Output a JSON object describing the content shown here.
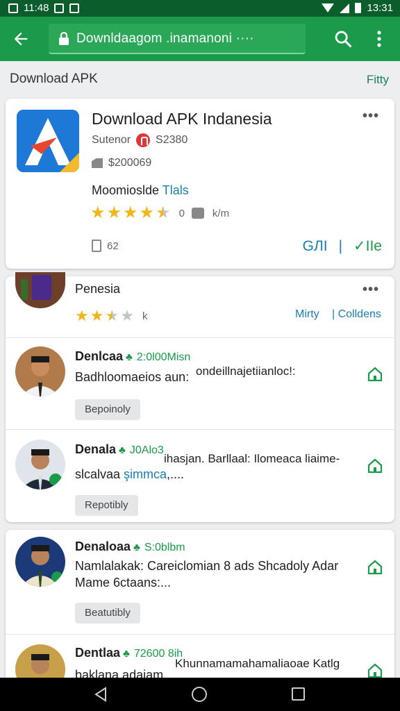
{
  "status_bar": {
    "time_left": "11:48",
    "time_right": "13:31"
  },
  "app_bar": {
    "url": "Downldaagom .inamanoni ····"
  },
  "section": {
    "title": "Download APK",
    "action": "Fitty"
  },
  "app_card": {
    "title": "Download APK Indanesia",
    "developer": "Sutenor",
    "developer_badge": "S2380",
    "price": "$200069",
    "mode_label": "Moomioslde",
    "mode_accent": "Tlals",
    "rating": 4.5,
    "rating_count": "0",
    "rating_unit": "k/m",
    "size": "62",
    "action_left": "GЛI",
    "action_sep": "|",
    "action_right": "✓IIe"
  },
  "list_card_1": {
    "featured": {
      "title": "Penesia",
      "rating": 2.5,
      "rating_unit": "k",
      "link_left": "Mirty",
      "link_right": "| Colldens"
    },
    "rows": [
      {
        "title": "Denlcaa",
        "meta": "2:0l00Misn",
        "line1": "Badhloomaeios aun:",
        "line1_tail": "ondeillnajetiianloc!:",
        "line2": "",
        "chip": "Bepoinoly"
      },
      {
        "title": "Denala",
        "meta": "J0Alo3",
        "line1": "slcalvaa ",
        "line1_accent": "şimmca",
        "line1_end": ",....",
        "line0": "ihasjan. Barllaal: Ilomeaca liaime-",
        "chip": "Repotibly"
      }
    ]
  },
  "list_card_2": {
    "rows": [
      {
        "title": "Denaloaa",
        "meta": "S:0blbm",
        "line1": "Namlalakak: Careiclomian 8 ads Shcadoly Adar",
        "line2": "Mame 6ctaans:...",
        "chip": "Beatutibly"
      },
      {
        "title": "Dentlaa",
        "meta": "72600 8ih",
        "line1": "Khunnamamahamaliaoae Katlg",
        "line2": "baklana adaiam"
      }
    ]
  },
  "colors": {
    "brand_green": "#1a9a4a",
    "status_green": "#0b5d2b",
    "accent_blue": "#1a7fb0",
    "star_gold": "#f2b51a"
  }
}
